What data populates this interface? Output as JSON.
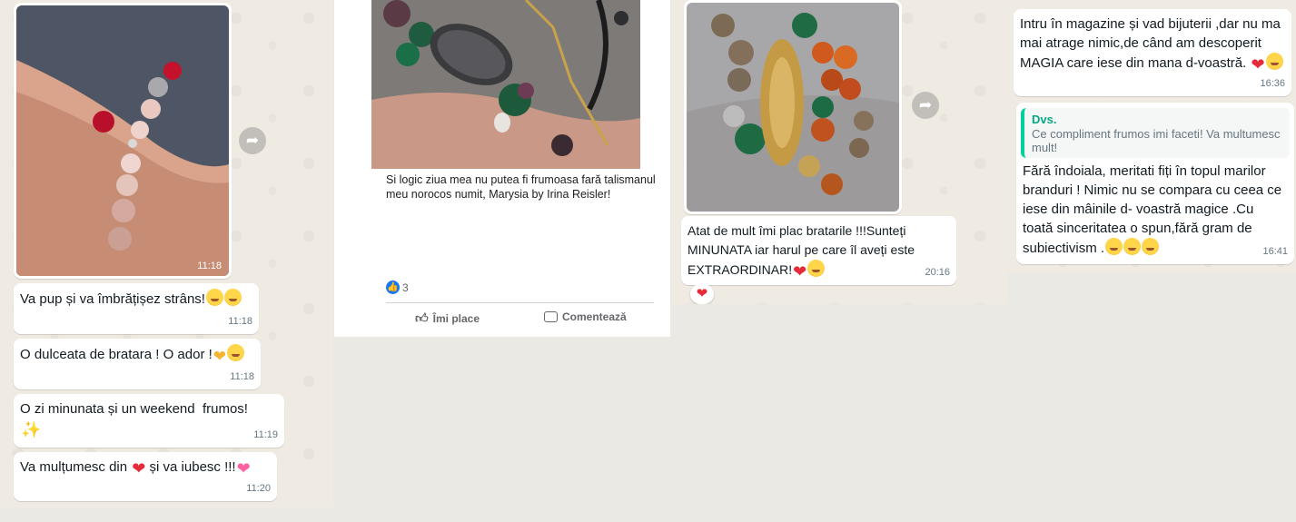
{
  "panel1": {
    "image_time": "11:18",
    "messages": [
      {
        "text": "Va pup și va îmbrățișez strâns!",
        "emoji": [
          "hug",
          "kiss"
        ],
        "time": "11:18"
      },
      {
        "text": "O dulceata de bratara ! O ador !",
        "emoji": [
          "hands",
          "kiss"
        ],
        "time": "11:18"
      },
      {
        "text": "O zi minunata și un weekend  frumos!",
        "emoji": [
          "wand"
        ],
        "time": "11:19"
      },
      {
        "text": "Va mulțumesc din ",
        "text2": " și va iubesc !!!",
        "emoji": [
          "heart",
          "pinkheart"
        ],
        "time": "11:20"
      }
    ]
  },
  "panel2": {
    "caption": "Si logic ziua mea nu putea fi frumoasa fară talismanul meu norocos numit, Marysia by Irina Reisler!",
    "likes": "3",
    "like_label": "Îmi place",
    "comment_label": "Comentează"
  },
  "panel3": {
    "message": "Atat de mult îmi plac bratarile !!!Sunteți MINUNATA iar harul pe care îl aveți este EXTRAORDINAR!",
    "time": "20:16",
    "reaction": "heart"
  },
  "panel4": {
    "message1": "Intru în magazine și vad bijuterii ,dar nu ma mai atrage nimic,de când am descoperit MAGIA care iese din mana d-voastră. ",
    "time1": "16:36",
    "quote_author": "Dvs.",
    "quote_text": "Ce compliment frumos imi faceti! Va multumesc mult!",
    "message2": "Fără îndoiala, meritati fiți în topul marilor branduri ! Nimic nu se compara cu ceea ce iese din mâinile d- voastră magice .Cu toată sinceritatea o spun,fără gram de subiectivism .",
    "time2": "16:41"
  },
  "colors": {
    "chat_bg": "#efeae2",
    "fb_blue": "#1877f2",
    "quote_green": "#06cf9c",
    "heart": "#e52a3a"
  }
}
